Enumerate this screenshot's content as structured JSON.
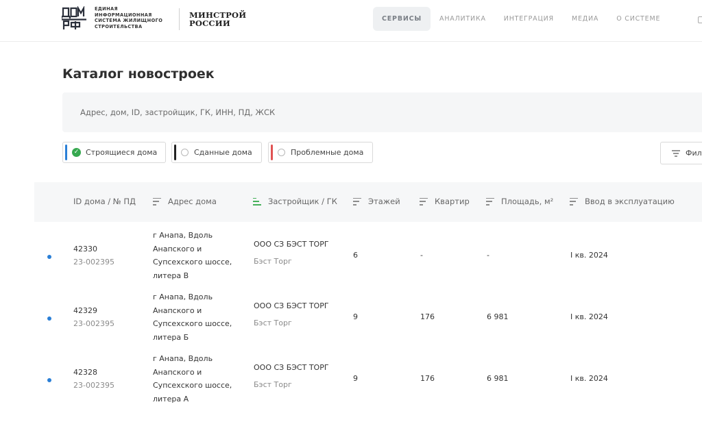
{
  "header": {
    "logo_text": "ЕДИНАЯ\nИНФОРМАЦИОННАЯ\nСИСТЕМА ЖИЛИЩНОГО\nСТРОИТЕЛЬСТВА",
    "ministry": "МИНСТРОЙ\nРОССИИ",
    "nav": [
      "СЕРВИСЫ",
      "АНАЛИТИКА",
      "ИНТЕГРАЦИЯ",
      "МЕДИА",
      "О СИСТЕМЕ"
    ]
  },
  "page_title": "Каталог новостроек",
  "search": {
    "placeholder": "Адрес, дом, ID, застройщик, ГК, ИНН, ПД, ЖСК"
  },
  "filters": [
    {
      "label": "Строящиеся дома",
      "color": "#2a7fd6",
      "selected": true
    },
    {
      "label": "Сданные дома",
      "color": "#222222",
      "selected": false
    },
    {
      "label": "Проблемные дома",
      "color": "#e05252",
      "selected": false
    }
  ],
  "filter_button": "Фил",
  "table": {
    "columns": [
      "ID дома / № ПД",
      "Адрес дома",
      "Застройщик / ГК",
      "Этажей",
      "Квартир",
      "Площадь, м²",
      "Ввод в эксплуатацию"
    ],
    "rows": [
      {
        "id": "42330",
        "pd": "23-002395",
        "address": [
          "г Анапа, Вдоль",
          "Анапского и",
          "Супсехского шоссе,",
          "литера В"
        ],
        "developer": "ООО СЗ БЭСТ ТОРГ",
        "group": "Бэст Торг",
        "floors": "6",
        "flats": "-",
        "area": "-",
        "date": "I кв. 2024"
      },
      {
        "id": "42329",
        "pd": "23-002395",
        "address": [
          "г Анапа, Вдоль",
          "Анапского и",
          "Супсехского шоссе,",
          "литера Б"
        ],
        "developer": "ООО СЗ БЭСТ ТОРГ",
        "group": "Бэст Торг",
        "floors": "9",
        "flats": "176",
        "area": "6 981",
        "date": "I кв. 2024"
      },
      {
        "id": "42328",
        "pd": "23-002395",
        "address": [
          "г Анапа, Вдоль",
          "Анапского и",
          "Супсехского шоссе,",
          "литера А"
        ],
        "developer": "ООО СЗ БЭСТ ТОРГ",
        "group": "Бэст Торг",
        "floors": "9",
        "flats": "176",
        "area": "6 981",
        "date": "I кв. 2024"
      }
    ]
  }
}
